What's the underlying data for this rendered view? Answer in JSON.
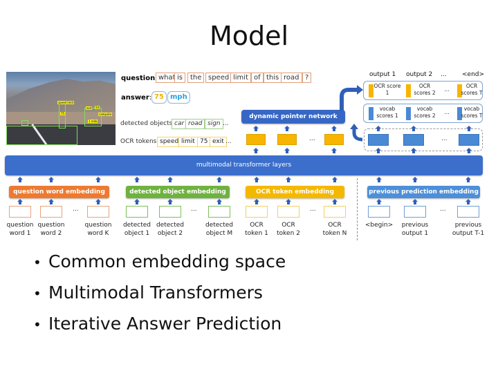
{
  "slide": {
    "title": "Model",
    "bullets": [
      "Common embedding space",
      "Multimodal Transformers",
      "Iterative Answer Prediction"
    ]
  },
  "diagram": {
    "image": {
      "description": "road scene with mountains",
      "ocr_tags": [
        "speed limit",
        "75",
        "exit",
        "54",
        "campsite",
        "1 mile"
      ]
    },
    "question": {
      "label": "question",
      "tokens": [
        "what",
        "is",
        "the",
        "speed",
        "limit",
        "of",
        "this",
        "road",
        "?"
      ]
    },
    "answer": {
      "label": "answer",
      "tokens": [
        "75",
        "mph"
      ],
      "colors": [
        "#f2b300",
        "#2aa0dc"
      ]
    },
    "detected_objects": {
      "label": "detected objects:",
      "tokens": [
        "car",
        "road",
        "sign"
      ],
      "ellipsis": "..."
    },
    "ocr_tokens": {
      "label": "OCR tokens:",
      "tokens": [
        "speed",
        "limit",
        "75",
        "exit"
      ],
      "ellipsis": "..."
    },
    "transformer_label": "multimodal transformer layers",
    "pointer_network_label": "dynamic pointer network",
    "outputs": {
      "headers": [
        "output 1",
        "output 2",
        "...",
        "<end>"
      ],
      "ocr_scores": [
        "OCR score 1",
        "OCR scores 2",
        "...",
        "OCR scores T"
      ],
      "vocab_scores": [
        "vocab scores 1",
        "vocab scores 2",
        "...",
        "vocab scores T"
      ]
    },
    "embeddings": [
      {
        "label": "question word embedding",
        "color": "#ee7a30",
        "border": "#e8a27a",
        "inputs": [
          "question word 1",
          "question word 2",
          "question word K"
        ]
      },
      {
        "label": "detected object embedding",
        "color": "#6fb23f",
        "border": "#7bbf5a",
        "inputs": [
          "detected object 1",
          "detected object 2",
          "detected object M"
        ]
      },
      {
        "label": "OCR token embedding",
        "color": "#f5b800",
        "border": "#f2cf62",
        "inputs": [
          "OCR token 1",
          "OCR token 2",
          "OCR token N"
        ]
      },
      {
        "label": "previous prediction embedding",
        "color": "#4d8fd8",
        "border": "#6d9fd4",
        "inputs": [
          "<begin>",
          "previous output 1",
          "previous output T-1"
        ]
      }
    ],
    "ellipsis": "..."
  }
}
